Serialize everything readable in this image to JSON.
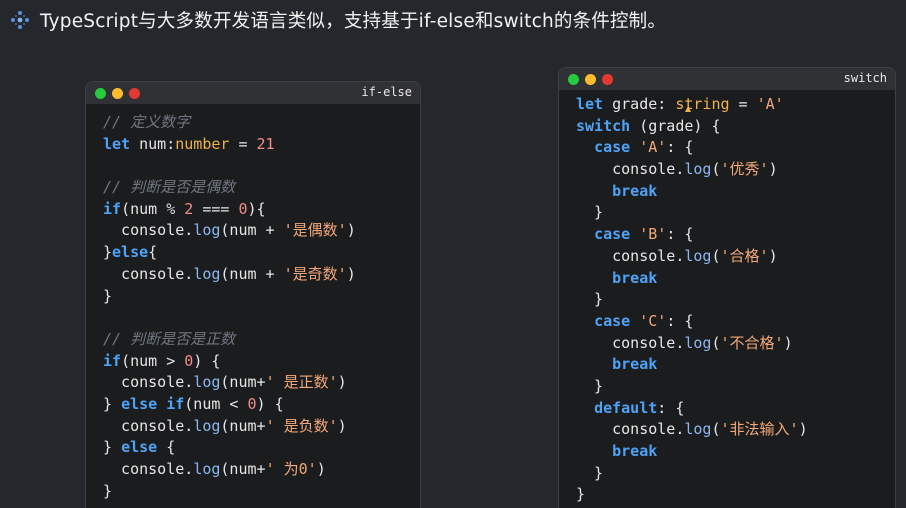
{
  "heading": {
    "icon": "sparkle-dots-icon",
    "text": "TypeScript与大多数开发语言类似，支持基于if-else和switch的条件控制。"
  },
  "colors": {
    "background": "#24272b",
    "window": "#1b1c1e",
    "keyword": "#4fa3f7",
    "type": "#f0b24c",
    "string": "#f2a878",
    "number": "#f38b8b",
    "comment": "#6f7680"
  },
  "if_window": {
    "label": "if-else",
    "lines": [
      [
        {
          "t": "// 定义数字",
          "c": "cm"
        }
      ],
      [
        {
          "t": "let",
          "c": "kw"
        },
        {
          "t": " num:"
        },
        {
          "t": "number",
          "c": "ty"
        },
        {
          "t": " = "
        },
        {
          "t": "21",
          "c": "num"
        }
      ],
      [
        {
          "t": ""
        }
      ],
      [
        {
          "t": "// 判断是否是偶数",
          "c": "cm"
        }
      ],
      [
        {
          "t": "if",
          "c": "kw"
        },
        {
          "t": "(num "
        },
        {
          "t": "%",
          "c": "op"
        },
        {
          "t": " "
        },
        {
          "t": "2",
          "c": "num"
        },
        {
          "t": " === "
        },
        {
          "t": "0",
          "c": "num"
        },
        {
          "t": "){"
        }
      ],
      [
        {
          "t": "  console."
        },
        {
          "t": "log",
          "c": "fn"
        },
        {
          "t": "(num + "
        },
        {
          "t": "'是偶数'",
          "c": "str"
        },
        {
          "t": ")"
        }
      ],
      [
        {
          "t": "}"
        },
        {
          "t": "else",
          "c": "kw"
        },
        {
          "t": "{"
        }
      ],
      [
        {
          "t": "  console."
        },
        {
          "t": "log",
          "c": "fn"
        },
        {
          "t": "(num + "
        },
        {
          "t": "'是奇数'",
          "c": "str"
        },
        {
          "t": ")"
        }
      ],
      [
        {
          "t": "}"
        }
      ],
      [
        {
          "t": ""
        }
      ],
      [
        {
          "t": "// 判断是否是正数",
          "c": "cm"
        }
      ],
      [
        {
          "t": "if",
          "c": "kw"
        },
        {
          "t": "(num > "
        },
        {
          "t": "0",
          "c": "num"
        },
        {
          "t": ") {"
        }
      ],
      [
        {
          "t": "  console."
        },
        {
          "t": "log",
          "c": "fn"
        },
        {
          "t": "(num+"
        },
        {
          "t": "' 是正数'",
          "c": "str"
        },
        {
          "t": ")"
        }
      ],
      [
        {
          "t": "} "
        },
        {
          "t": "else",
          "c": "kw"
        },
        {
          "t": " "
        },
        {
          "t": "if",
          "c": "kw"
        },
        {
          "t": "(num < "
        },
        {
          "t": "0",
          "c": "num"
        },
        {
          "t": ") {"
        }
      ],
      [
        {
          "t": "  console."
        },
        {
          "t": "log",
          "c": "fn"
        },
        {
          "t": "(num+"
        },
        {
          "t": "' 是负数'",
          "c": "str"
        },
        {
          "t": ")"
        }
      ],
      [
        {
          "t": "} "
        },
        {
          "t": "else",
          "c": "kw"
        },
        {
          "t": " {"
        }
      ],
      [
        {
          "t": "  console."
        },
        {
          "t": "log",
          "c": "fn"
        },
        {
          "t": "(num+"
        },
        {
          "t": "' 为0'",
          "c": "str"
        },
        {
          "t": ")"
        }
      ],
      [
        {
          "t": "}"
        }
      ]
    ]
  },
  "switch_window": {
    "label": "switch",
    "lines": [
      [
        {
          "t": "let",
          "c": "kw"
        },
        {
          "t": " grade: "
        },
        {
          "t": "string",
          "c": "ty"
        },
        {
          "t": " = "
        },
        {
          "t": "'A'",
          "c": "str"
        }
      ],
      [
        {
          "t": "switch",
          "c": "kw"
        },
        {
          "t": " (grade) {"
        }
      ],
      [
        {
          "t": "  "
        },
        {
          "t": "case",
          "c": "kw"
        },
        {
          "t": " "
        },
        {
          "t": "'A'",
          "c": "str"
        },
        {
          "t": ": {"
        }
      ],
      [
        {
          "t": "    console."
        },
        {
          "t": "log",
          "c": "fn"
        },
        {
          "t": "("
        },
        {
          "t": "'优秀'",
          "c": "str"
        },
        {
          "t": ")"
        }
      ],
      [
        {
          "t": "    "
        },
        {
          "t": "break",
          "c": "kw"
        }
      ],
      [
        {
          "t": "  }"
        }
      ],
      [
        {
          "t": "  "
        },
        {
          "t": "case",
          "c": "kw"
        },
        {
          "t": " "
        },
        {
          "t": "'B'",
          "c": "str"
        },
        {
          "t": ": {"
        }
      ],
      [
        {
          "t": "    console."
        },
        {
          "t": "log",
          "c": "fn"
        },
        {
          "t": "("
        },
        {
          "t": "'合格'",
          "c": "str"
        },
        {
          "t": ")"
        }
      ],
      [
        {
          "t": "    "
        },
        {
          "t": "break",
          "c": "kw"
        }
      ],
      [
        {
          "t": "  }"
        }
      ],
      [
        {
          "t": "  "
        },
        {
          "t": "case",
          "c": "kw"
        },
        {
          "t": " "
        },
        {
          "t": "'C'",
          "c": "str"
        },
        {
          "t": ": {"
        }
      ],
      [
        {
          "t": "    console."
        },
        {
          "t": "log",
          "c": "fn"
        },
        {
          "t": "("
        },
        {
          "t": "'不合格'",
          "c": "str"
        },
        {
          "t": ")"
        }
      ],
      [
        {
          "t": "    "
        },
        {
          "t": "break",
          "c": "kw"
        }
      ],
      [
        {
          "t": "  }"
        }
      ],
      [
        {
          "t": "  "
        },
        {
          "t": "default",
          "c": "kw"
        },
        {
          "t": ": {"
        }
      ],
      [
        {
          "t": "    console."
        },
        {
          "t": "log",
          "c": "fn"
        },
        {
          "t": "("
        },
        {
          "t": "'非法输入'",
          "c": "str"
        },
        {
          "t": ")"
        }
      ],
      [
        {
          "t": "    "
        },
        {
          "t": "break",
          "c": "kw"
        }
      ],
      [
        {
          "t": "  }"
        }
      ],
      [
        {
          "t": "}"
        }
      ]
    ]
  }
}
